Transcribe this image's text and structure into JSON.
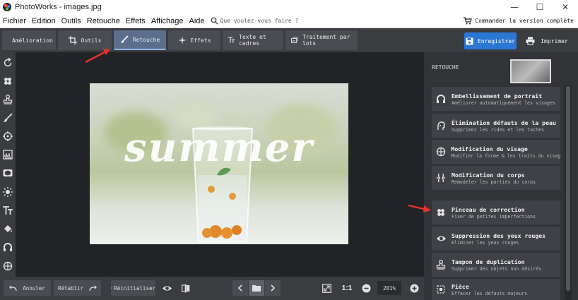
{
  "window": {
    "title": "PhotoWorks - images.jpg",
    "minimize_label": "—",
    "maximize_label": "☐",
    "close_label": "✕"
  },
  "menu": {
    "items": [
      "Fichier",
      "Edition",
      "Outils",
      "Retouche",
      "Effets",
      "Affichage",
      "Aide"
    ],
    "search_placeholder": "Que voulez-vous faire ?",
    "order_label": "Commander la version complète"
  },
  "toolbar": {
    "tabs": [
      {
        "label": "Amélioration",
        "icon": "sliders-icon",
        "active": false
      },
      {
        "label": "Outils",
        "icon": "crop-icon",
        "active": false
      },
      {
        "label": "Retouche",
        "icon": "brush-icon",
        "active": true
      },
      {
        "label": "Effets",
        "icon": "sparkle-icon",
        "active": false
      },
      {
        "label": "Texte et cadres",
        "icon": "text-icon",
        "active": false
      },
      {
        "label": "Traitement par lots",
        "icon": "batch-icon",
        "active": false
      }
    ],
    "save_label": "Enregistrer",
    "print_label": "Imprimer"
  },
  "image": {
    "overlay_text": "summer"
  },
  "panel": {
    "title": "RETOUCHE",
    "items": [
      {
        "title": "Embellissement de portrait",
        "desc": "Améliorer automatiquement les visages",
        "icon": "portrait-icon"
      },
      {
        "title": "Élimination défauts de la peau",
        "desc": "Supprimez les rides et les taches",
        "icon": "skin-icon"
      },
      {
        "title": "Modification du visage",
        "desc": "Modifier la forme & les traits du visage",
        "icon": "face-icon"
      },
      {
        "title": "Modification du corps",
        "desc": "Remodeler les parties du corps",
        "icon": "body-icon"
      },
      {
        "title": "Pinceau de correction",
        "desc": "Fixer de petites imperfections",
        "icon": "healing-brush-icon"
      },
      {
        "title": "Suppression des yeux rouges",
        "desc": "Eliminer les yeux rouges",
        "icon": "eye-icon"
      },
      {
        "title": "Tampon de duplication",
        "desc": "Supprimer des objets non désirés",
        "icon": "stamp-icon"
      },
      {
        "title": "Pièce",
        "desc": "Effacer les défauts majeurs",
        "icon": "patch-icon"
      }
    ]
  },
  "bottom": {
    "undo_label": "Annuler",
    "redo_label": "Rétablir",
    "reset_label": "Réinitialiser",
    "ratio_label": "1:1",
    "zoom_value": "201%"
  },
  "colors": {
    "accent": "#2a77d4",
    "arrow": "#e8322a"
  }
}
